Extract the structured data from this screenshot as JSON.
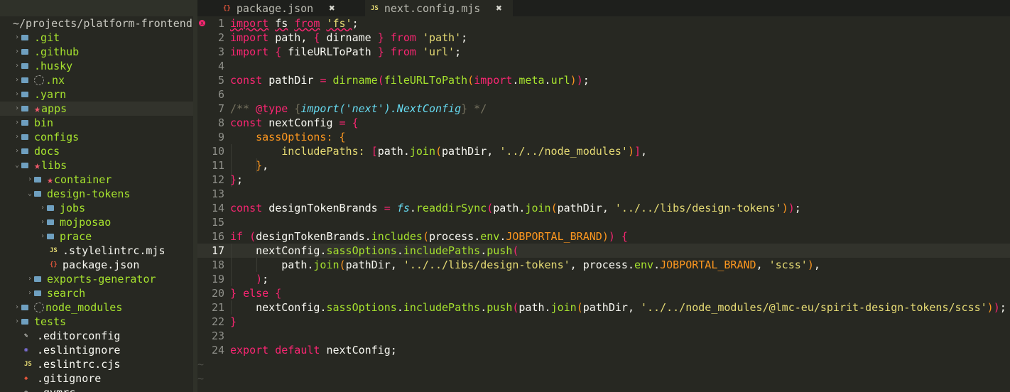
{
  "tabs": [
    {
      "label": "package.json",
      "icon": "json-file-icon",
      "icon_glyph": "{}",
      "close": "✖"
    },
    {
      "label": "next.config.mjs",
      "icon": "js-file-icon",
      "icon_glyph": "JS",
      "close": "✖"
    }
  ],
  "sidebar": {
    "root": "~/projects/platform-frontend",
    "items": [
      {
        "label": ".git",
        "kind": "dir",
        "depth": 0
      },
      {
        "label": ".github",
        "kind": "dir",
        "depth": 0
      },
      {
        "label": ".husky",
        "kind": "dir",
        "depth": 0
      },
      {
        "label": ".nx",
        "kind": "dir-ignored",
        "depth": 0
      },
      {
        "label": ".yarn",
        "kind": "dir",
        "depth": 0
      },
      {
        "label": "apps",
        "kind": "dir-starred",
        "depth": 0
      },
      {
        "label": "bin",
        "kind": "dir",
        "depth": 0
      },
      {
        "label": "configs",
        "kind": "dir",
        "depth": 0
      },
      {
        "label": "docs",
        "kind": "dir",
        "depth": 0
      },
      {
        "label": "libs",
        "kind": "dir-starred-open",
        "depth": 0
      },
      {
        "label": "container",
        "kind": "dir-starred",
        "depth": 1
      },
      {
        "label": "design-tokens",
        "kind": "dir-open",
        "depth": 1
      },
      {
        "label": "jobs",
        "kind": "dir",
        "depth": 2
      },
      {
        "label": "mojposao",
        "kind": "dir",
        "depth": 2
      },
      {
        "label": "prace",
        "kind": "dir",
        "depth": 2
      },
      {
        "label": ".stylelintrc.mjs",
        "kind": "file-js",
        "depth": 2
      },
      {
        "label": "package.json",
        "kind": "file-json",
        "depth": 2
      },
      {
        "label": "exports-generator",
        "kind": "dir",
        "depth": 1
      },
      {
        "label": "search",
        "kind": "dir",
        "depth": 1
      },
      {
        "label": "node_modules",
        "kind": "dir-ignored",
        "depth": 0
      },
      {
        "label": "tests",
        "kind": "dir",
        "depth": 0
      },
      {
        "label": ".editorconfig",
        "kind": "file-config",
        "depth": 0
      },
      {
        "label": ".eslintignore",
        "kind": "file-eslint",
        "depth": 0
      },
      {
        "label": ".eslintrc.cjs",
        "kind": "file-js",
        "depth": 0
      },
      {
        "label": ".gitignore",
        "kind": "file-git",
        "depth": 0
      },
      {
        "label": ".gvmrc",
        "kind": "file-other",
        "depth": 0
      }
    ]
  },
  "editor": {
    "line_numbers": [
      "1",
      "2",
      "3",
      "4",
      "5",
      "6",
      "7",
      "8",
      "9",
      "10",
      "11",
      "12",
      "13",
      "14",
      "15",
      "16",
      "17",
      "18",
      "19",
      "20",
      "21",
      "22",
      "23",
      "24"
    ],
    "active_line": "17",
    "empty_marker": "~",
    "error_marker": "x",
    "tokens": {
      "import": "import",
      "fs": "fs",
      "from": "from",
      "s_fs": "'fs'",
      "semi": ";",
      "path": "path",
      "dirname": "dirname",
      "s_path": "'path'",
      "fileURLToPath": "fileURLToPath",
      "s_url": "'url'",
      "const": "const",
      "pathDir": "pathDir",
      "eq": "=",
      "meta": "meta",
      "url": "url",
      "doc_open": "/** ",
      "doc_type": "@type",
      "doc_brace_open": " {",
      "doc_import": "import",
      "doc_paren_str": "('next')",
      "doc_nc": ".NextConfig",
      "doc_close": "} */",
      "nextConfig": "nextConfig",
      "sassOptions": "sassOptions",
      "includePaths": "includePaths",
      "join": "join",
      "s_nm": "'../../node_modules'",
      "designTokenBrands": "designTokenBrands",
      "readdirSync": "readdirSync",
      "s_libs_dt": "'../../libs/design-tokens'",
      "if": "if",
      "includes": "includes",
      "process": "process",
      "env": "env",
      "JOBPORTAL_BRAND": "JOBPORTAL_BRAND",
      "push": "push",
      "s_scss": "'scss'",
      "else": "else",
      "s_spirit": "'../../node_modules/@lmc-eu/spirit-design-tokens/scss'",
      "export": "export",
      "default": "default"
    }
  }
}
